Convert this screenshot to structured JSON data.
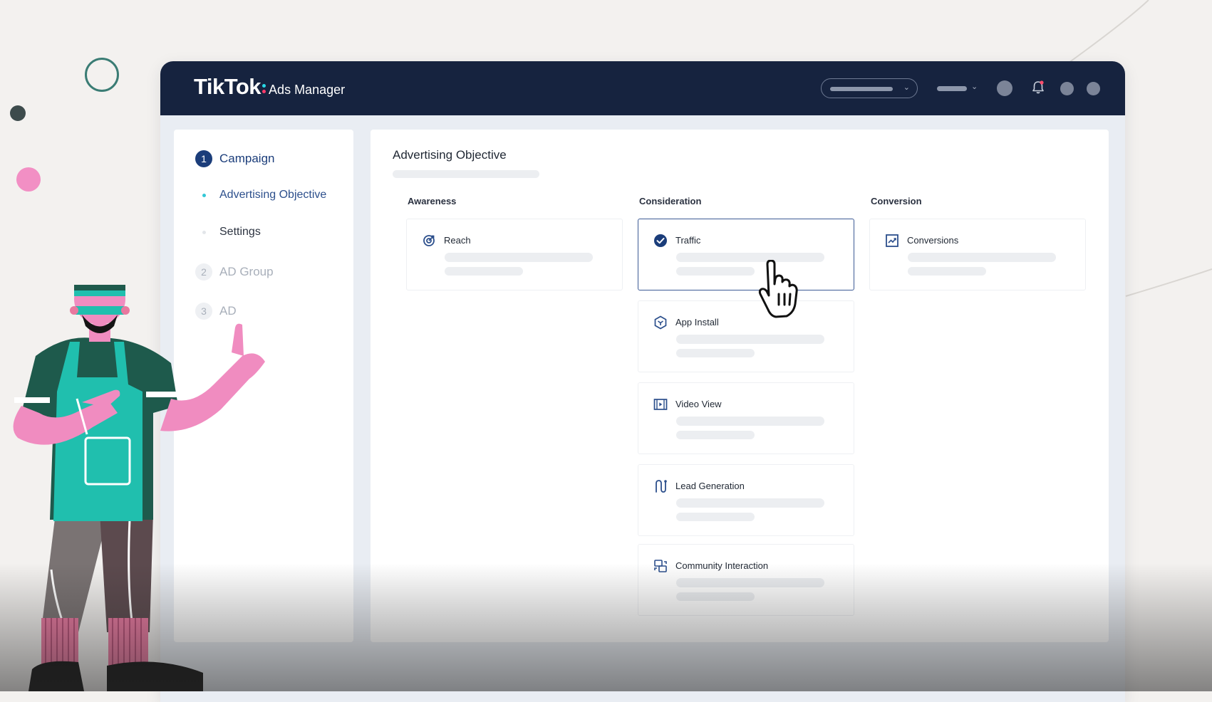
{
  "app": {
    "brand": "TikTok",
    "product": "Ads Manager"
  },
  "topbar": {
    "icons": [
      "chevron-down-icon",
      "chevron-down-icon",
      "avatar",
      "bell-icon",
      "circle-icon",
      "circle-icon"
    ]
  },
  "sidebar": {
    "steps": [
      {
        "num": "1",
        "label": "Campaign",
        "active": true
      },
      {
        "num": "2",
        "label": "AD Group",
        "active": false
      },
      {
        "num": "3",
        "label": "AD",
        "active": false
      }
    ],
    "substeps": [
      {
        "label": "Advertising Objective",
        "active": true
      },
      {
        "label": "Settings",
        "active": false
      }
    ]
  },
  "main": {
    "title": "Advertising Objective",
    "columns": [
      {
        "heading": "Awareness"
      },
      {
        "heading": "Consideration"
      },
      {
        "heading": "Conversion"
      }
    ],
    "cards": {
      "reach": {
        "label": "Reach",
        "icon": "target-icon"
      },
      "traffic": {
        "label": "Traffic",
        "icon": "check-circle-icon",
        "selected": true
      },
      "conversions": {
        "label": "Conversions",
        "icon": "chart-up-icon"
      },
      "app_install": {
        "label": "App Install",
        "icon": "hexagon-icon"
      },
      "video_view": {
        "label": "Video View",
        "icon": "film-icon"
      },
      "lead_generation": {
        "label": "Lead Generation",
        "icon": "funnel-icon"
      },
      "community_interaction": {
        "label": "Community Interaction",
        "icon": "community-icon"
      }
    }
  },
  "colors": {
    "topbar": "#16233f",
    "accent": "#1b3d7a",
    "active_dot": "#33c7d6",
    "selected_border": "#3c5a95"
  }
}
